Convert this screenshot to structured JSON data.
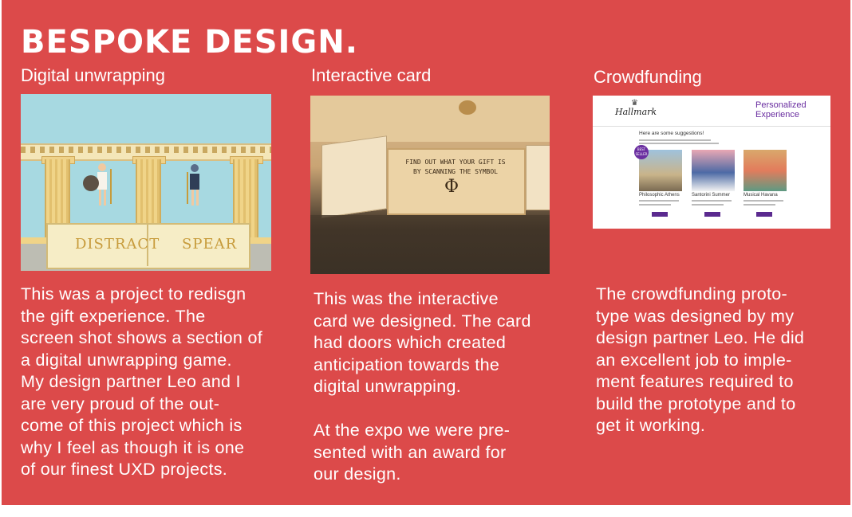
{
  "title": "BESPOKE DESIGN.",
  "columns": [
    {
      "heading": "Digital unwrapping",
      "image": {
        "buttons": [
          "DISTRACT",
          "SPEAR"
        ]
      },
      "body": "This was a project to redisgn\nthe gift experience. The\nscreen shot shows a section of\na digital unwrapping game.\nMy design partner Leo and I\nare very proud of the out-\ncome of this project which is\nwhy I feel as though it is one\nof our finest UXD projects."
    },
    {
      "heading": "Interactive card",
      "image": {
        "card_text": "FIND OUT WHAT YOUR GIFT IS\nBY SCANNING THE SYMBOL",
        "symbol": "Φ"
      },
      "body": "This was the interactive\ncard we designed. The card\nhad doors which created\nanticipation towards the\ndigital unwrapping.\n\nAt the expo we were pre-\nsented with an award for\nour design."
    },
    {
      "heading": "Crowdfunding",
      "image": {
        "logo": "Hallmark",
        "header": "Personalized\nExperience",
        "suggestions_heading": "Here are some suggestions!",
        "badge": "BEST SELLER",
        "cards": [
          "Philosophic Athens",
          "Santorini Summer",
          "Musical Havana"
        ]
      },
      "body": "The crowdfunding proto-\ntype was designed by my\ndesign partner Leo. He did\nan excellent job to imple-\nment features required to\nbuild the prototype and to\nget it working."
    }
  ],
  "colors": {
    "background": "#dc4a4a",
    "text": "#ffffff",
    "accent_purple": "#6a2ea0"
  }
}
